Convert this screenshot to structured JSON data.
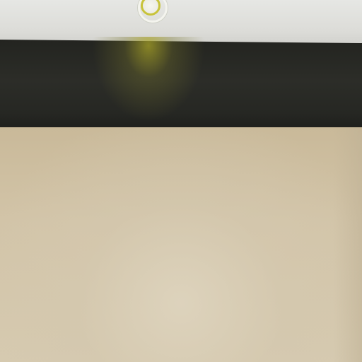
{
  "scene": {
    "type": "3d-room-view",
    "colors": {
      "ceiling": "#e0e1dd",
      "dark_band": "#2a2b27",
      "wall": "#d3c7ae",
      "light_accent": "#c8c33a"
    },
    "icons": {
      "ceiling_light": "ceiling-light-icon"
    }
  }
}
